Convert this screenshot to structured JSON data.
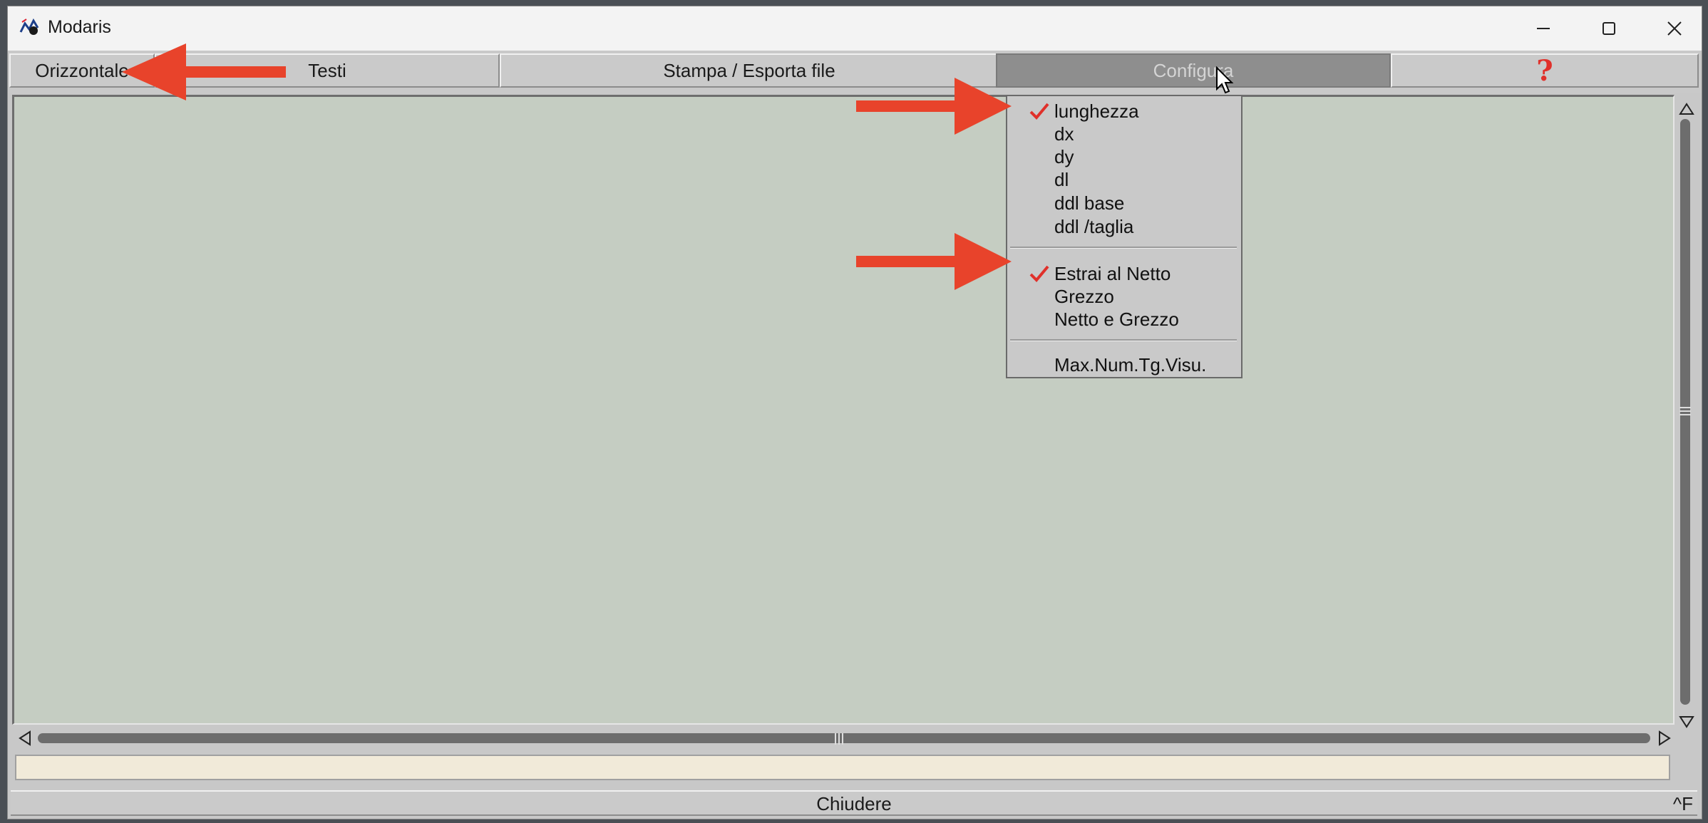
{
  "window": {
    "title": "Modaris"
  },
  "menubar": {
    "items": [
      "Orizzontale",
      "Testi",
      "Stampa / Esporta file",
      "Configura"
    ],
    "help_glyph": "?"
  },
  "dropdown": {
    "group1": [
      {
        "label": "lunghezza",
        "checked": true
      },
      {
        "label": "dx",
        "checked": false
      },
      {
        "label": "dy",
        "checked": false
      },
      {
        "label": "dl",
        "checked": false
      },
      {
        "label": "ddl base",
        "checked": false
      },
      {
        "label": "ddl /taglia",
        "checked": false
      }
    ],
    "group2": [
      {
        "label": "Estrai al Netto",
        "checked": true
      },
      {
        "label": "Grezzo",
        "checked": false
      },
      {
        "label": "Netto e Grezzo",
        "checked": false
      }
    ],
    "group3": [
      {
        "label": "Max.Num.Tg.Visu.",
        "checked": false
      }
    ]
  },
  "footer": {
    "close_label": "Chiudere",
    "shortcut": "^F"
  },
  "colors": {
    "accent_arrow": "#e8432b",
    "check": "#e0302a",
    "canvas": "#c5cdc2"
  }
}
